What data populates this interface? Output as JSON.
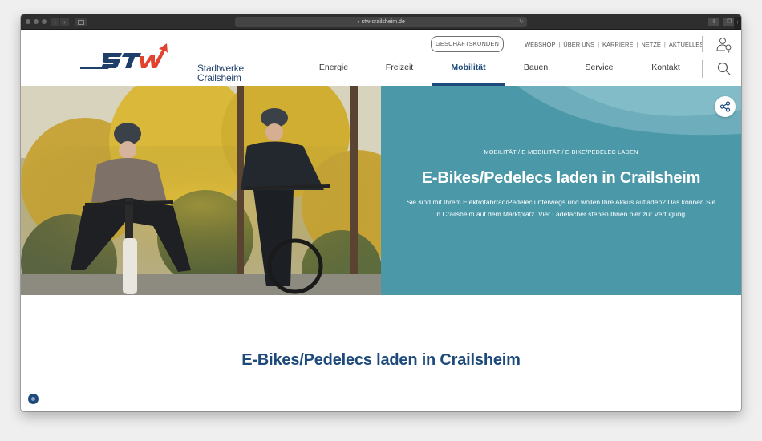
{
  "browser": {
    "url": "stw-crailsheim.de",
    "back_icon": "‹",
    "forward_icon": "›"
  },
  "logo": {
    "mark": "STW",
    "line1": "Stadtwerke",
    "line2": "Crailsheim"
  },
  "header": {
    "business_button": "GESCHÄFTSKUNDEN",
    "meta_links": [
      "WEBSHOP",
      "ÜBER UNS",
      "KARRIERE",
      "NETZE",
      "AKTUELLES"
    ],
    "meta_separator": "|"
  },
  "main_nav": {
    "items": [
      {
        "label": "Energie",
        "active": false
      },
      {
        "label": "Freizeit",
        "active": false
      },
      {
        "label": "Mobilität",
        "active": true
      },
      {
        "label": "Bauen",
        "active": false
      },
      {
        "label": "Service",
        "active": false
      },
      {
        "label": "Kontakt",
        "active": false
      }
    ]
  },
  "hero": {
    "breadcrumb": "MOBILITÄT / E-MOBILITÄT / E-BIKE/PEDELEC LADEN",
    "title": "E-Bikes/Pedelecs laden in Crailsheim",
    "text": "Sie sind mit Ihrem Elektrofahrrad/Pedelec unterwegs und wollen Ihre Akkus aufladen? Das können Sie in Crailsheim auf dem Marktplatz. Vier Ladefächer stehen Ihnen hier zur Verfügung.",
    "image_alt": "Zwei lachende Radfahrer mit Helmen auf E-Bikes im Herbstwald"
  },
  "content": {
    "title": "E-Bikes/Pedelecs laden in Crailsheim"
  },
  "colors": {
    "brand_blue": "#1d4a7a",
    "teal": "#4a98a8",
    "logo_red": "#e2432e"
  }
}
